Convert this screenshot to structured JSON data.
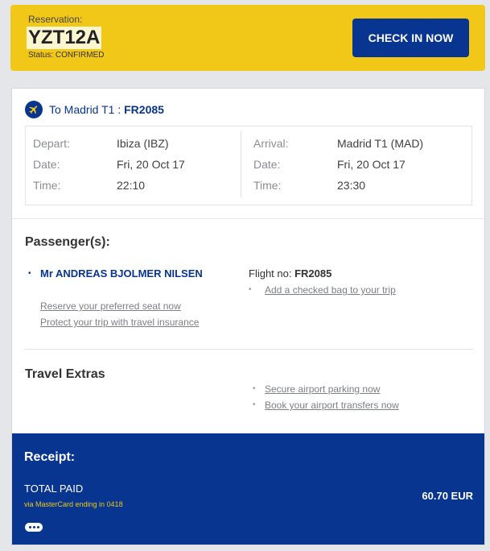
{
  "reservation": {
    "label": "Reservation:",
    "code": "YZT12A",
    "status": "Status: CONFIRMED",
    "checkin_label": "CHECK IN NOW"
  },
  "flight": {
    "title_prefix": "To Madrid T1 : ",
    "flight_code": "FR2085",
    "depart": {
      "rows": [
        {
          "label": "Depart:",
          "value": "Ibiza (IBZ)"
        },
        {
          "label": "Date:",
          "value": "Fri, 20 Oct 17"
        },
        {
          "label": "Time:",
          "value": "22:10"
        }
      ]
    },
    "arrival": {
      "rows": [
        {
          "label": "Arrival:",
          "value": "Madrid T1 (MAD)"
        },
        {
          "label": "Date:",
          "value": "Fri, 20 Oct 17"
        },
        {
          "label": "Time:",
          "value": "23:30"
        }
      ]
    }
  },
  "passengers": {
    "title": "Passenger(s):",
    "name": "Mr ANDREAS BJOLMER NILSEN",
    "flight_no_label": "Flight no: ",
    "flight_no": "FR2085",
    "add_bag_link": "Add a checked bag to your trip",
    "seat_link": "Reserve your preferred seat now",
    "insurance_link": "Protect your trip with travel insurance"
  },
  "extras": {
    "title": "Travel Extras",
    "parking_link": "Secure airport parking now",
    "transfers_link": "Book your airport transfers now"
  },
  "receipt": {
    "title": "Receipt:",
    "total_label": "TOTAL PAID",
    "via": "via MasterCard ending in 0418",
    "amount": "60.70 EUR"
  },
  "icons": {
    "plane": "plane-icon",
    "more": "more-dots-icon"
  },
  "colors": {
    "brand_blue": "#073590",
    "brand_yellow": "#f1c817"
  }
}
